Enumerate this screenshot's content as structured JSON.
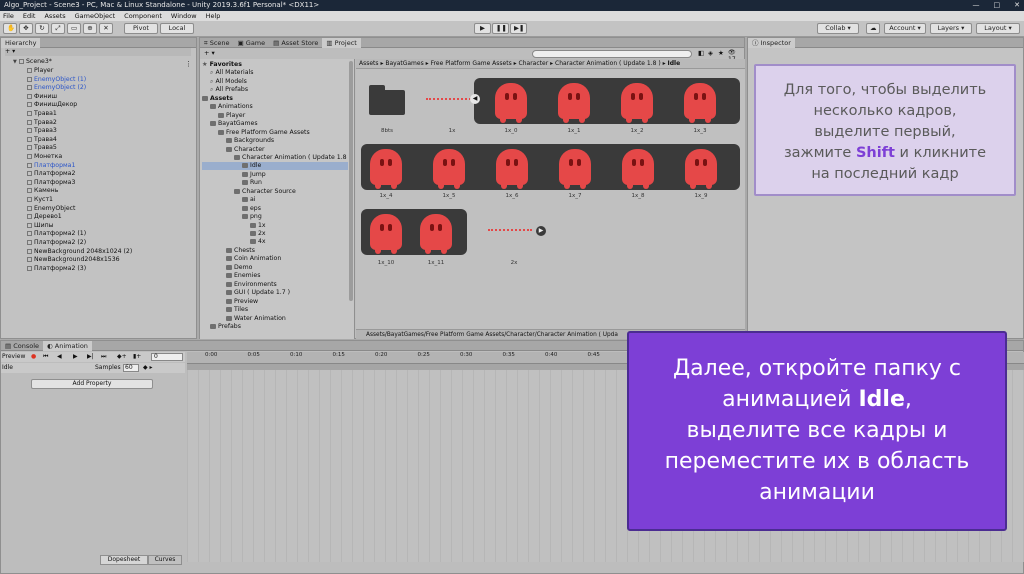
{
  "window": {
    "title": "Algo_Project - Scene3 - PC, Mac & Linux Standalone - Unity 2019.3.6f1 Personal* <DX11>",
    "controls": [
      "—",
      "□",
      "✕"
    ]
  },
  "menu": [
    "File",
    "Edit",
    "Assets",
    "GameObject",
    "Component",
    "Window",
    "Help"
  ],
  "toolbar": {
    "pivot": "Pivot",
    "local": "Local",
    "collab": "Collab",
    "account": "Account",
    "layers": "Layers",
    "layout": "Layout",
    "play": "▶",
    "pause": "❚❚",
    "step": "▶❚"
  },
  "hierarchy": {
    "tab": "Hierarchy",
    "scene": "Scene3*",
    "items": [
      {
        "label": "Player",
        "color": "black"
      },
      {
        "label": "EnemyObject (1)",
        "color": "blue"
      },
      {
        "label": "EnemyObject (2)",
        "color": "blue"
      },
      {
        "label": "Финиш",
        "color": "black"
      },
      {
        "label": "ФинишДекор",
        "color": "black"
      },
      {
        "label": "Трава1",
        "color": "black"
      },
      {
        "label": "Трава2",
        "color": "black"
      },
      {
        "label": "Трава3",
        "color": "black"
      },
      {
        "label": "Трава4",
        "color": "black"
      },
      {
        "label": "Трава5",
        "color": "black"
      },
      {
        "label": "Монетка",
        "color": "black"
      },
      {
        "label": "Платформа1",
        "color": "blue"
      },
      {
        "label": "Платформа2",
        "color": "black"
      },
      {
        "label": "Платформа3",
        "color": "black"
      },
      {
        "label": "Камень",
        "color": "black"
      },
      {
        "label": "Куст1",
        "color": "black"
      },
      {
        "label": "EnemyObject",
        "color": "black"
      },
      {
        "label": "Дерево1",
        "color": "black"
      },
      {
        "label": "Шипы",
        "color": "black"
      },
      {
        "label": "Платформа2 (1)",
        "color": "black"
      },
      {
        "label": "Платформа2 (2)",
        "color": "black"
      },
      {
        "label": "NewBackground 2048x1024 (2)",
        "color": "black"
      },
      {
        "label": "NewBackground2048x1536",
        "color": "black"
      },
      {
        "label": "Платформа2 (3)",
        "color": "black"
      }
    ]
  },
  "center_tabs": [
    "Scene",
    "Game",
    "Asset Store",
    "Project"
  ],
  "project": {
    "count": "17",
    "breadcrumb": [
      "Assets",
      "BayatGames",
      "Free Platform Game Assets",
      "Character",
      "Character Animation ( Update 1.8 )",
      "Idle"
    ],
    "footer_path": "Assets/BayatGames/Free Platform Game Assets/Character/Character Animation ( Upda",
    "tree": [
      {
        "label": "Favorites",
        "kind": "star",
        "bold": true
      },
      {
        "label": "All Materials",
        "kind": "search"
      },
      {
        "label": "All Models",
        "kind": "search"
      },
      {
        "label": "All Prefabs",
        "kind": "search"
      },
      {
        "label": "Assets",
        "kind": "folder",
        "bold": true
      },
      {
        "label": "Animations",
        "kind": "folder"
      },
      {
        "label": "Player",
        "kind": "folder"
      },
      {
        "label": "BayatGames",
        "kind": "folder"
      },
      {
        "label": "Free Platform Game Assets",
        "kind": "folder"
      },
      {
        "label": "Backgrounds",
        "kind": "folder"
      },
      {
        "label": "Character",
        "kind": "folder"
      },
      {
        "label": "Character Animation ( Update 1.8 )",
        "kind": "folder"
      },
      {
        "label": "Idle",
        "kind": "folder",
        "selected": true
      },
      {
        "label": "Jump",
        "kind": "folder"
      },
      {
        "label": "Run",
        "kind": "folder"
      },
      {
        "label": "Character Source",
        "kind": "folder"
      },
      {
        "label": "ai",
        "kind": "folder"
      },
      {
        "label": "eps",
        "kind": "folder"
      },
      {
        "label": "png",
        "kind": "folder"
      },
      {
        "label": "1x",
        "kind": "folder"
      },
      {
        "label": "2x",
        "kind": "folder"
      },
      {
        "label": "4x",
        "kind": "folder"
      },
      {
        "label": "Chests",
        "kind": "folder"
      },
      {
        "label": "Coin Animation",
        "kind": "folder"
      },
      {
        "label": "Demo",
        "kind": "folder"
      },
      {
        "label": "Enemies",
        "kind": "folder"
      },
      {
        "label": "Environments",
        "kind": "folder"
      },
      {
        "label": "GUI ( Update 1.7 )",
        "kind": "folder"
      },
      {
        "label": "Preview",
        "kind": "folder"
      },
      {
        "label": "Tiles",
        "kind": "folder"
      },
      {
        "label": "Water Animation",
        "kind": "folder"
      },
      {
        "label": "Prefabs",
        "kind": "folder"
      }
    ],
    "grid": [
      [
        "8bts",
        "1x",
        "1x_0",
        "1x_1",
        "1x_2",
        "1x_3"
      ],
      [
        "1x_4",
        "1x_5",
        "1x_6",
        "1x_7",
        "1x_8",
        "1x_9"
      ],
      [
        "1x_10",
        "1x_11",
        "2x"
      ]
    ]
  },
  "inspector": {
    "tab": "Inspector"
  },
  "bottom_tabs": [
    "Console",
    "Animation"
  ],
  "animation": {
    "preview": "Preview",
    "clip": "Idle",
    "samples_label": "Samples",
    "samples_value": "60",
    "frame": "0",
    "add_property": "Add Property",
    "ruler": [
      "0:00",
      "0:05",
      "0:10",
      "0:15",
      "0:20",
      "0:25",
      "0:30",
      "0:35",
      "0:40",
      "0:45",
      "0:50",
      "0:55",
      "1:00"
    ],
    "dopesheet": "Dopesheet",
    "curves": "Curves"
  },
  "callout1": {
    "line1": "Для того, чтобы выделить",
    "line2": "несколько кадров,",
    "line3": "выделите первый,",
    "line4a": "зажмите ",
    "line4b": "Shift",
    "line4c": " и кликните",
    "line5": "на последний кадр"
  },
  "callout2": {
    "line1": "Далее, откройте папку с",
    "line2a": "анимацией ",
    "line2b": "Idle",
    "line2c": ",",
    "line3": "выделите все кадры и",
    "line4": "переместите их в область",
    "line5": "анимации"
  },
  "colors": {
    "callout_purple": "#7d3fd6",
    "callout_lavender": "#dcd1ec",
    "sprite_red": "#e54848"
  }
}
